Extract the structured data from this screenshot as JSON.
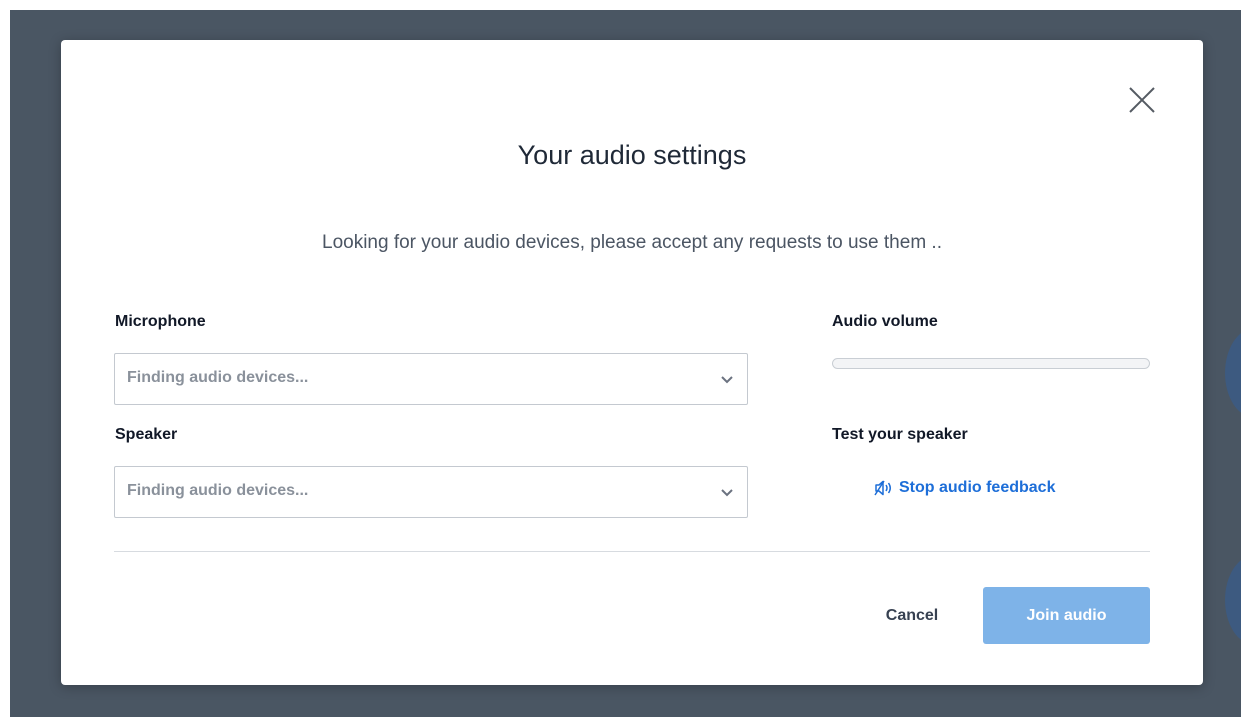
{
  "modal": {
    "title": "Your audio settings",
    "subtitle": "Looking for your audio devices, please accept any requests to use them  ..",
    "close_icon": "close-icon"
  },
  "microphone": {
    "label": "Microphone",
    "value": "Finding audio devices...",
    "chevron_icon": "chevron-down-icon"
  },
  "speaker": {
    "label": "Speaker",
    "value": "Finding audio devices...",
    "chevron_icon": "chevron-down-icon"
  },
  "volume": {
    "label": "Audio volume",
    "level": 0
  },
  "speaker_test": {
    "label": "Test your speaker",
    "link_label": "Stop audio feedback",
    "icon": "speaker-icon"
  },
  "actions": {
    "cancel_label": "Cancel",
    "join_label": "Join audio"
  },
  "colors": {
    "backdrop": "#4a5663",
    "link": "#1d6ed8",
    "primary_disabled": "#7eb3e8"
  }
}
